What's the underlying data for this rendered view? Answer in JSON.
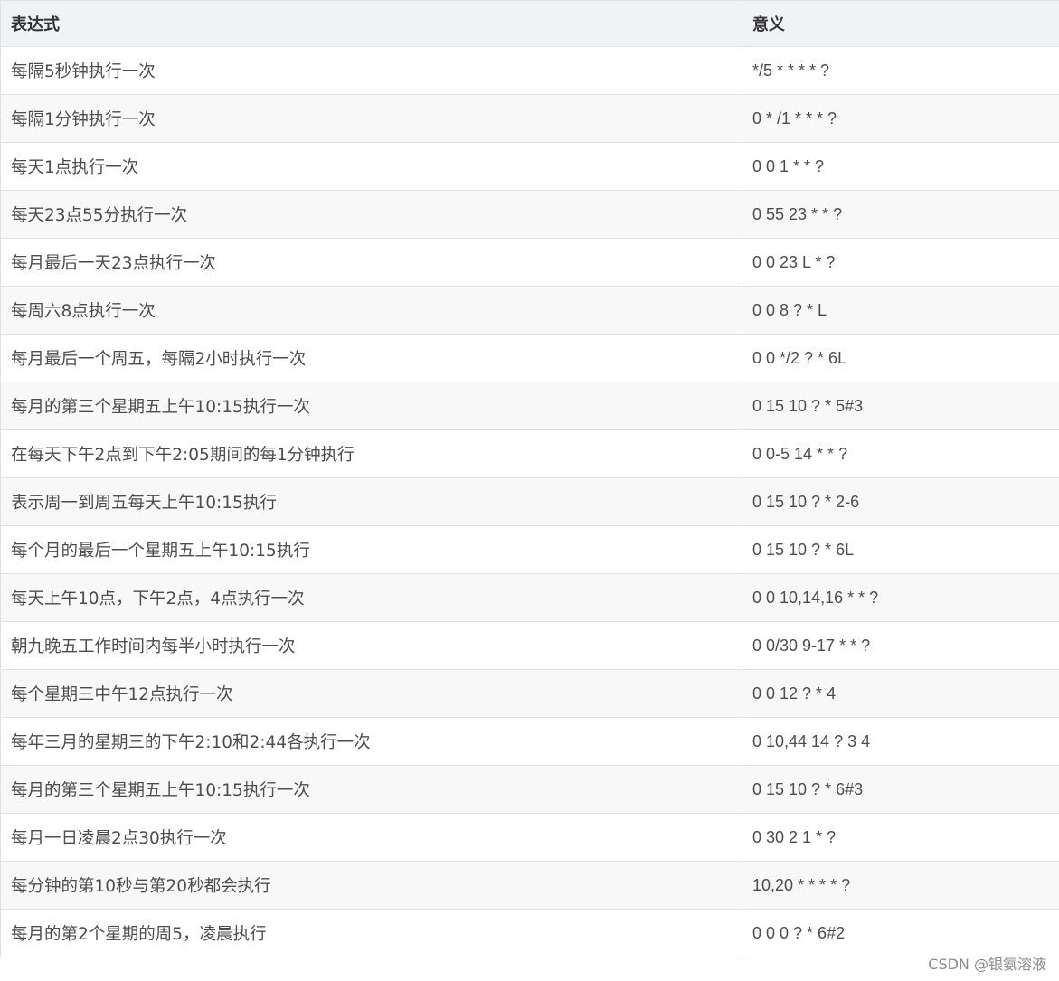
{
  "table": {
    "headers": [
      "表达式",
      "意义"
    ],
    "rows": [
      [
        "每隔5秒钟执行一次",
        "*/5 * * * * ?"
      ],
      [
        "每隔1分钟执行一次",
        "0 * /1 * * * ?"
      ],
      [
        "每天1点执行一次",
        "0 0 1 * * ?"
      ],
      [
        "每天23点55分执行一次",
        "0 55 23 * * ?"
      ],
      [
        "每月最后一天23点执行一次",
        "0 0 23 L * ?"
      ],
      [
        "每周六8点执行一次",
        "0 0 8 ? * L"
      ],
      [
        "每月最后一个周五，每隔2小时执行一次",
        "0 0 */2 ? * 6L"
      ],
      [
        "每月的第三个星期五上午10:15执行一次",
        "0 15 10 ? * 5#3"
      ],
      [
        "在每天下午2点到下午2:05期间的每1分钟执行",
        "0 0-5 14 * * ?"
      ],
      [
        "表示周一到周五每天上午10:15执行",
        "0 15 10 ? * 2-6"
      ],
      [
        "每个月的最后一个星期五上午10:15执行",
        "0 15 10 ? * 6L"
      ],
      [
        "每天上午10点，下午2点，4点执行一次",
        "0 0 10,14,16 * * ?"
      ],
      [
        "朝九晚五工作时间内每半小时执行一次",
        "0 0/30 9-17 * * ?"
      ],
      [
        "每个星期三中午12点执行一次",
        "0 0 12 ? * 4"
      ],
      [
        "每年三月的星期三的下午2:10和2:44各执行一次",
        "0 10,44 14 ? 3 4"
      ],
      [
        "每月的第三个星期五上午10:15执行一次",
        "0 15 10 ? * 6#3"
      ],
      [
        "每月一日凌晨2点30执行一次",
        "0 30 2 1 * ?"
      ],
      [
        "每分钟的第10秒与第20秒都会执行",
        "10,20 * * * * ?"
      ],
      [
        "每月的第2个星期的周5，凌晨执行",
        "0 0 0 ? * 6#2"
      ]
    ]
  },
  "watermark": "CSDN @银氨溶液"
}
